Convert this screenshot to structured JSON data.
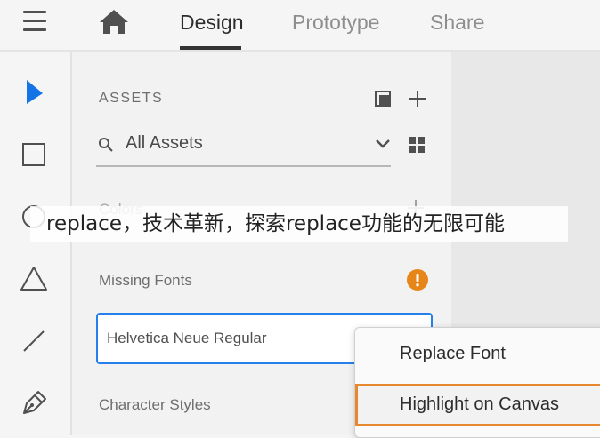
{
  "header": {
    "tabs": [
      {
        "label": "Design",
        "active": true
      },
      {
        "label": "Prototype",
        "active": false
      },
      {
        "label": "Share",
        "active": false
      }
    ]
  },
  "toolbar": {
    "tools": [
      "select-arrow-icon",
      "rectangle-icon",
      "ellipse-icon",
      "triangle-icon",
      "line-icon",
      "pen-icon"
    ]
  },
  "assets": {
    "title": "ASSETS",
    "search": {
      "value": "All Assets"
    },
    "sections": {
      "colors": "Colors",
      "missing_fonts": "Missing Fonts",
      "character_styles": "Character Styles"
    },
    "missing_font": {
      "value": "Helvetica Neue Regular"
    }
  },
  "context_menu": {
    "items": [
      {
        "label": "Replace Font"
      },
      {
        "label": "Highlight on Canvas"
      }
    ]
  },
  "overlay": {
    "text": "replace，技术革新，探索replace功能的无限可能"
  },
  "colors": {
    "accent_blue": "#2680eb",
    "select_blue": "#1473e6",
    "warning_orange": "#e68619",
    "highlight_border": "#e8882e"
  }
}
